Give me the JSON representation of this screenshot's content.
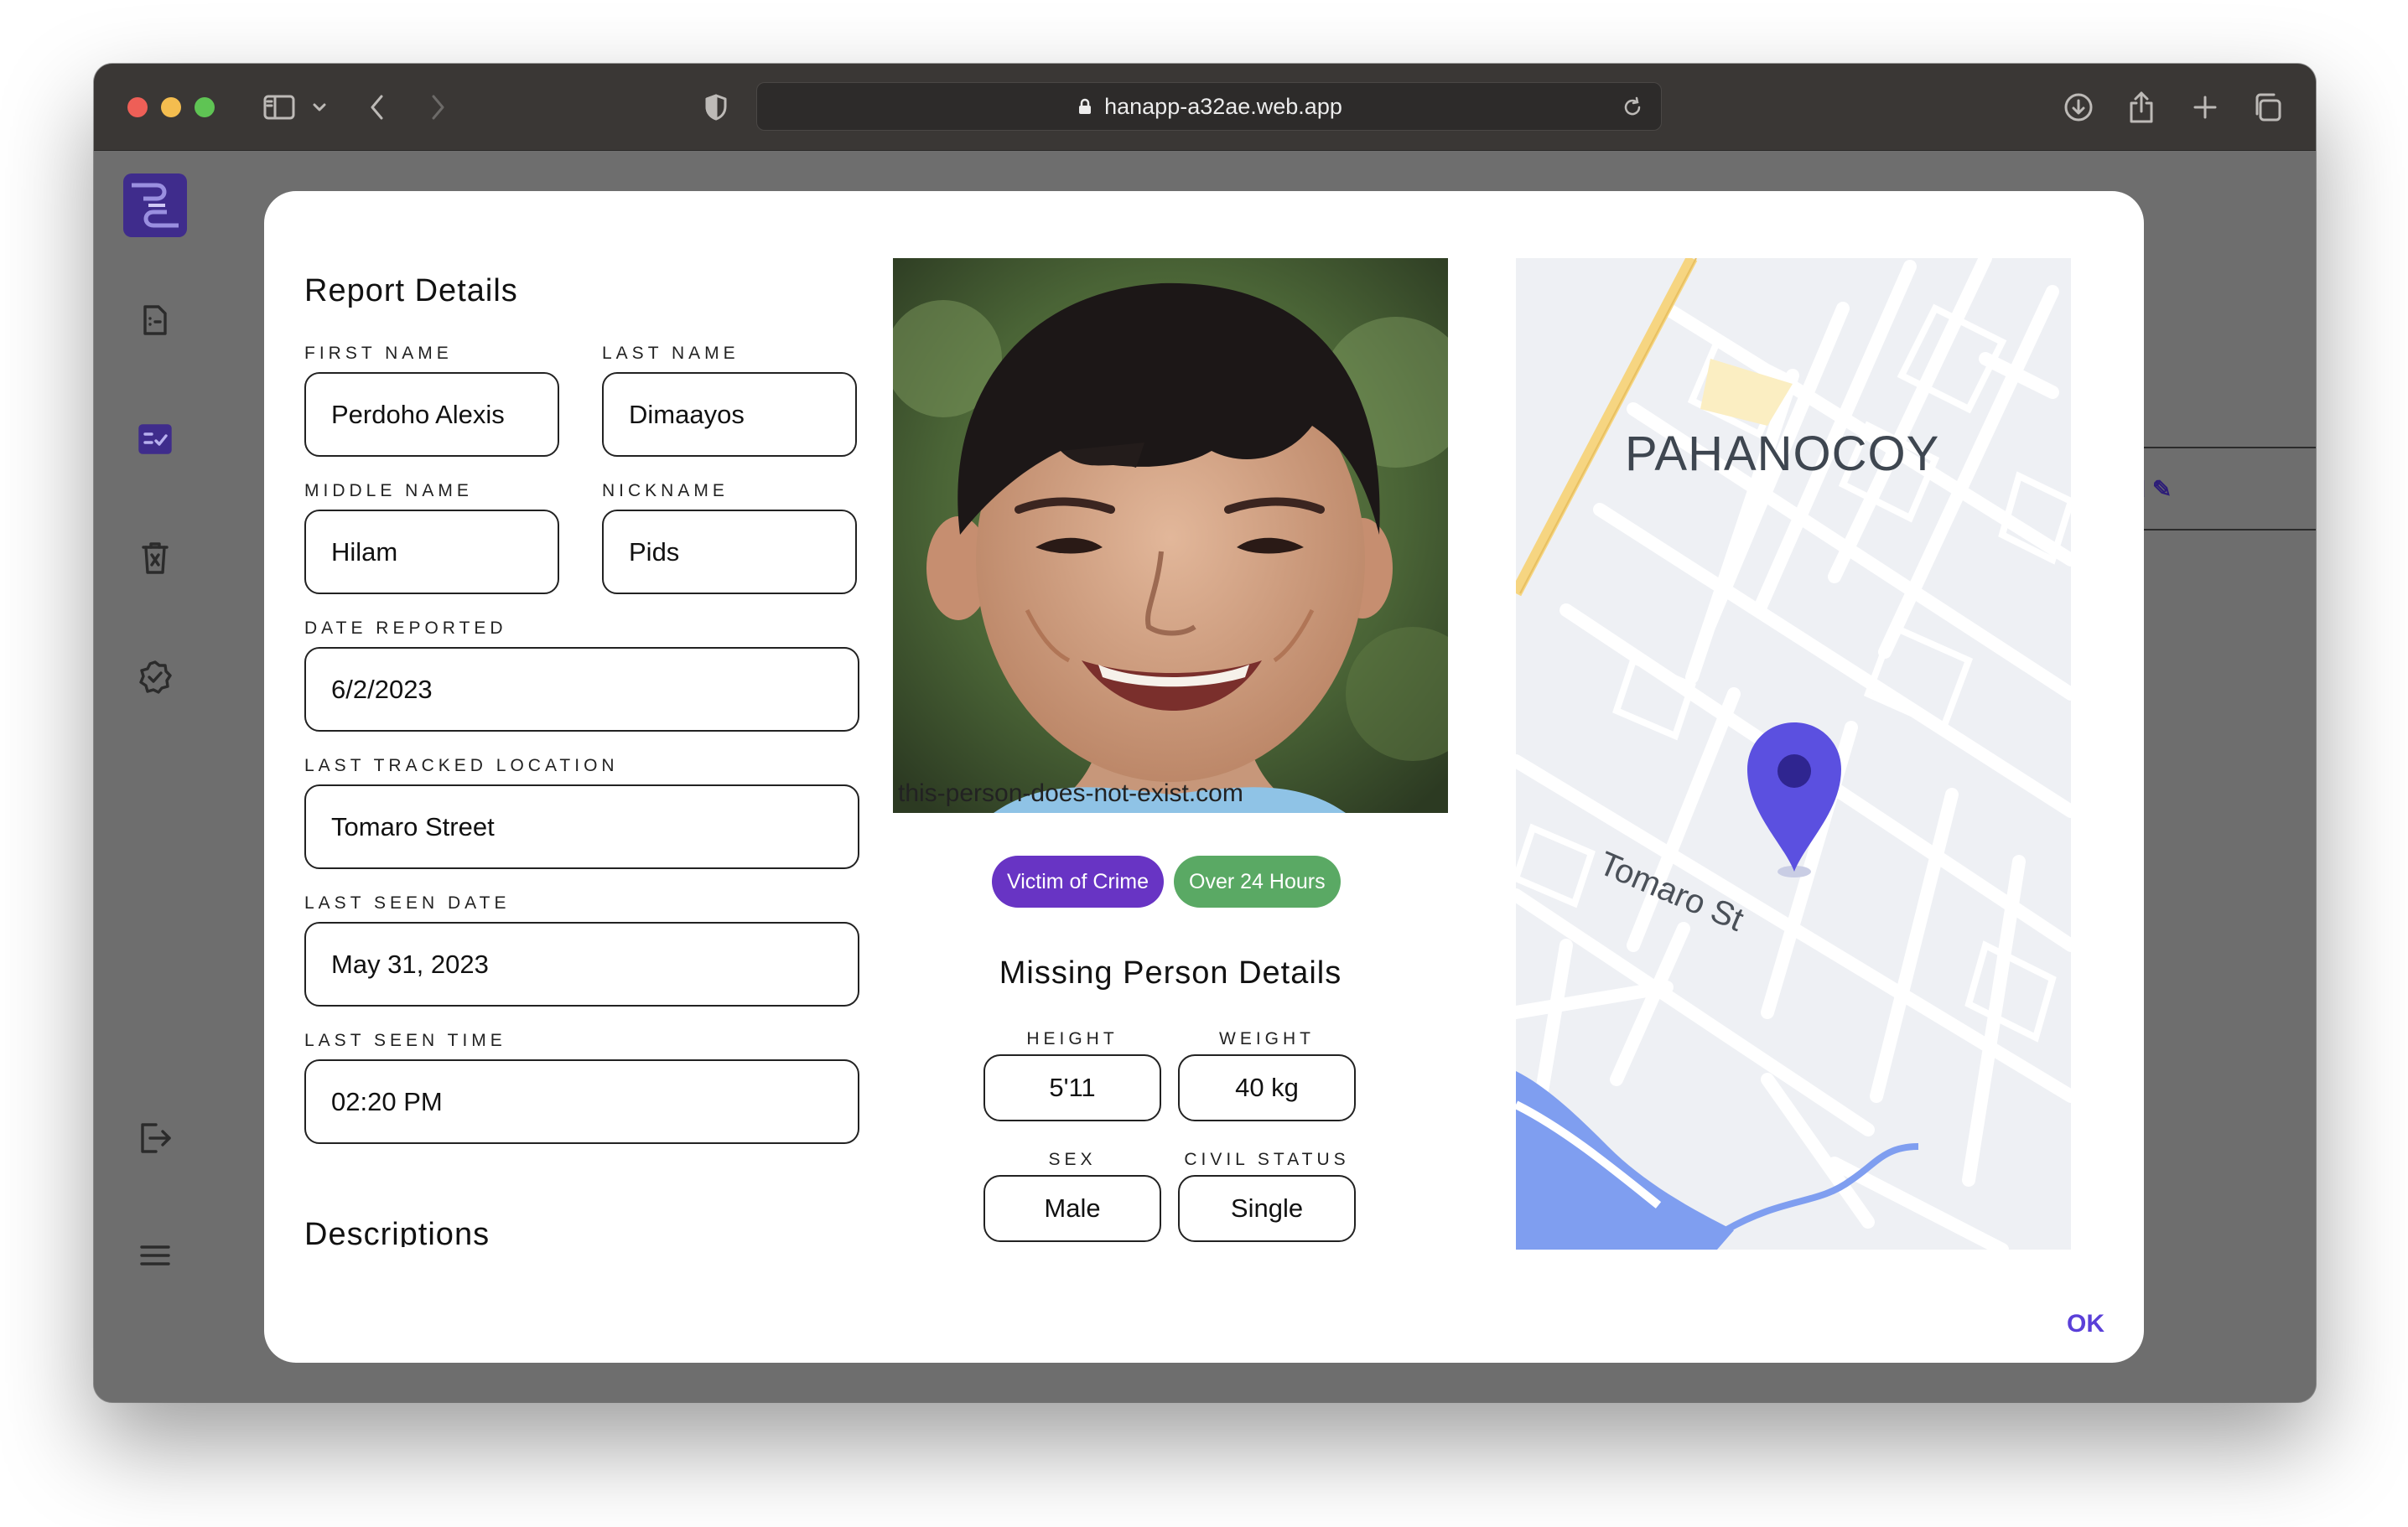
{
  "browser": {
    "url": "hanapp-a32ae.web.app"
  },
  "sidebar": {
    "items": [
      "reports-icon",
      "tasks-icon",
      "trash-icon",
      "verified-icon",
      "logout-icon",
      "menu-icon"
    ]
  },
  "background": {
    "card_label": "d ✎"
  },
  "modal": {
    "report_title": "Report Details",
    "fields": {
      "first_name_label": "FIRST NAME",
      "first_name": "Perdoho Alexis",
      "last_name_label": "LAST NAME",
      "last_name": "Dimaayos",
      "middle_name_label": "MIDDLE NAME",
      "middle_name": "Hilam",
      "nickname_label": "NICKNAME",
      "nickname": "Pids",
      "date_reported_label": "DATE REPORTED",
      "date_reported": "6/2/2023",
      "last_location_label": "LAST TRACKED LOCATION",
      "last_location": "Tomaro Street",
      "last_seen_date_label": "LAST SEEN DATE",
      "last_seen_date": "May 31, 2023",
      "last_seen_time_label": "LAST SEEN TIME",
      "last_seen_time": "02:20 PM"
    },
    "descriptions_title": "Descriptions",
    "photo_caption": "this-person-does-not-exist.com",
    "badges": [
      "Victim of Crime",
      "Over 24 Hours"
    ],
    "badge_colors": {
      "victim": "#6834c4",
      "hours": "#5aa964"
    },
    "missing_title": "Missing Person Details",
    "details": {
      "height_label": "HEIGHT",
      "height": "5'11",
      "weight_label": "WEIGHT",
      "weight": "40 kg",
      "sex_label": "SEX",
      "sex": "Male",
      "civil_status_label": "CIVIL STATUS",
      "civil_status": "Single"
    },
    "map": {
      "place_label": "PAHANOCOY",
      "street_label": "Tomaro St",
      "pin_color": "#5b50e0"
    },
    "ok_label": "OK"
  }
}
